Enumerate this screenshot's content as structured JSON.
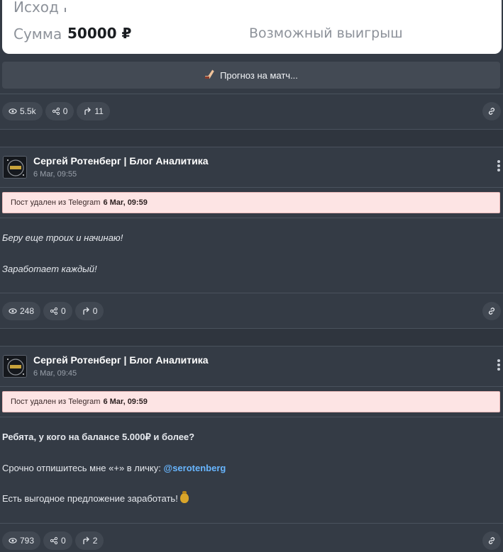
{
  "bet_card": {
    "outcome_label": "Исход",
    "sum_label": "Сумма",
    "sum_value": "50000 ₽",
    "possible_win_label": "Возможный выигрыш"
  },
  "forecast_button": {
    "icon": "hockey-stick-icon",
    "label": "Прогноз на матч..."
  },
  "top_stats": {
    "views": "5.5k",
    "shares": "0",
    "forwards": "11"
  },
  "posts": [
    {
      "author": "Сергей Ротенберг | Блог Аналитика",
      "time": "6 Mar, 09:55",
      "deleted_prefix": "Пост удален из Telegram",
      "deleted_time": "6 Mar, 09:59",
      "lines": [
        "Беру еще троих и начинаю!",
        "Заработает каждый!"
      ],
      "stats": {
        "views": "248",
        "shares": "0",
        "forwards": "0"
      }
    },
    {
      "author": "Сергей Ротенберг | Блог Аналитика",
      "time": "6 Mar, 09:45",
      "deleted_prefix": "Пост удален из Telegram",
      "deleted_time": "6 Mar, 09:59",
      "line1": "Ребята, у кого на балансе 5.000₽ и более?",
      "line2_prefix": "Срочно отпишитесь мне «+» в личку:",
      "mention": "@serotenberg",
      "line3": "Есть выгодное предложение заработать!",
      "line3_emoji": "money-bag-icon",
      "stats": {
        "views": "793",
        "shares": "0",
        "forwards": "2"
      }
    }
  ],
  "colors": {
    "background": "#343b45",
    "card": "#ffffff",
    "deleted_banner": "#fde4e4",
    "mention": "#68b6ff"
  }
}
